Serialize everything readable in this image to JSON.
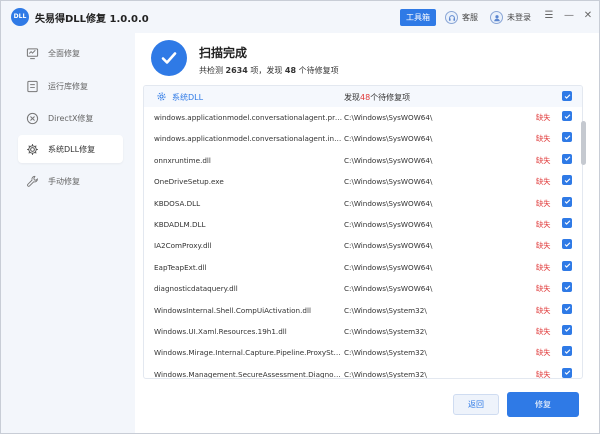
{
  "app": {
    "logo_text": "DLL",
    "title": "失易得DLL修复  1.0.0.0"
  },
  "titlebar": {
    "toolbox_label": "工具箱",
    "service_label": "客服",
    "login_label": "未登录",
    "menu_glyph": "☰",
    "minimize_glyph": "—",
    "close_glyph": "✕"
  },
  "sidebar": {
    "items": [
      {
        "label": "全面修复",
        "icon": "monitor-icon",
        "active": false
      },
      {
        "label": "运行库修复",
        "icon": "library-icon",
        "active": false
      },
      {
        "label": "DirectX修复",
        "icon": "x-circle-icon",
        "active": false
      },
      {
        "label": "系统DLL修复",
        "icon": "gear-icon",
        "active": true
      },
      {
        "label": "手动修复",
        "icon": "wrench-icon",
        "active": false
      }
    ]
  },
  "scan": {
    "title": "扫描完成",
    "summary_prefix": "共检测 ",
    "detected_count": "2634",
    "summary_middle": " 项，发现 ",
    "found_count": "48",
    "summary_suffix": " 个待修复项"
  },
  "list": {
    "header": {
      "label": "系统DLL",
      "found_prefix": "发现",
      "found_count": "48",
      "found_suffix": "个待修复项"
    },
    "rows": [
      {
        "name": "windows.applicationmodel.conversationalagent.proxy...",
        "path": "C:\\Windows\\SysWOW64\\",
        "status": "缺失"
      },
      {
        "name": "windows.applicationmodel.conversationalagent.intern...",
        "path": "C:\\Windows\\SysWOW64\\",
        "status": "缺失"
      },
      {
        "name": "onnxruntime.dll",
        "path": "C:\\Windows\\SysWOW64\\",
        "status": "缺失"
      },
      {
        "name": "OneDriveSetup.exe",
        "path": "C:\\Windows\\SysWOW64\\",
        "status": "缺失"
      },
      {
        "name": "KBDOSA.DLL",
        "path": "C:\\Windows\\SysWOW64\\",
        "status": "缺失"
      },
      {
        "name": "KBDADLM.DLL",
        "path": "C:\\Windows\\SysWOW64\\",
        "status": "缺失"
      },
      {
        "name": "IA2ComProxy.dll",
        "path": "C:\\Windows\\SysWOW64\\",
        "status": "缺失"
      },
      {
        "name": "EapTeapExt.dll",
        "path": "C:\\Windows\\SysWOW64\\",
        "status": "缺失"
      },
      {
        "name": "diagnosticdataquery.dll",
        "path": "C:\\Windows\\SysWOW64\\",
        "status": "缺失"
      },
      {
        "name": "WindowsInternal.Shell.CompUiActivation.dll",
        "path": "C:\\Windows\\System32\\",
        "status": "缺失"
      },
      {
        "name": "Windows.UI.Xaml.Resources.19h1.dll",
        "path": "C:\\Windows\\System32\\",
        "status": "缺失"
      },
      {
        "name": "Windows.Mirage.Internal.Capture.Pipeline.ProxyStub.dll",
        "path": "C:\\Windows\\System32\\",
        "status": "缺失"
      },
      {
        "name": "Windows.Management.SecureAssessment.Diagnostics...",
        "path": "C:\\Windows\\System32\\",
        "status": "缺失"
      }
    ]
  },
  "footer": {
    "back_label": "返回",
    "repair_label": "修复"
  },
  "colors": {
    "accent": "#2f7ae6",
    "missing": "#e03a3a"
  }
}
